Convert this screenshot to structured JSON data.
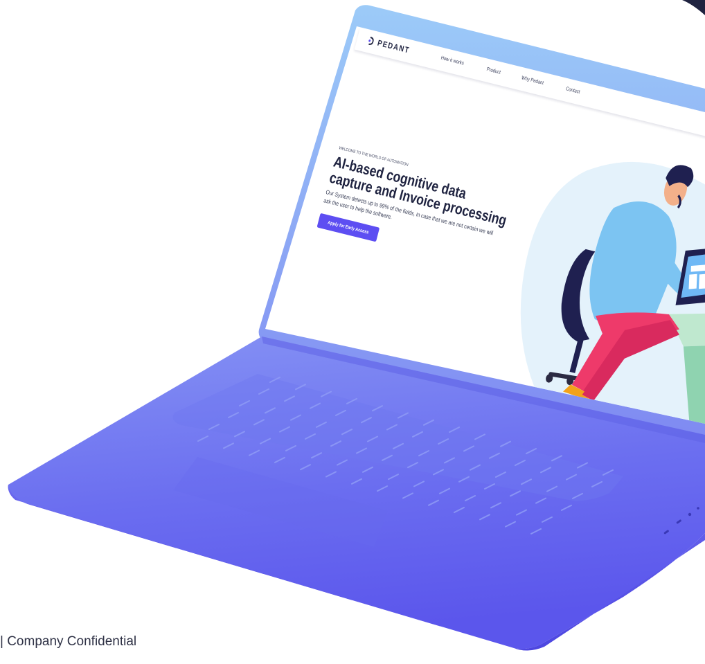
{
  "site": {
    "logo_text": "PEDANT",
    "nav": [
      "How it works",
      "Product",
      "Why Pedant",
      "Contact"
    ],
    "kicker": "WELCOME TO THE WORLD OF AUTOMATION",
    "title_lines": [
      "AI-based cognitive data",
      "capture and Invoice processing"
    ],
    "description": "Our System detects up to 99% of the fields, in case that we are not certain we will ask the user to help the software.",
    "cta_label": "Apply for Early Access"
  },
  "footer": {
    "confidential": "| Company Confidential"
  },
  "colors": {
    "accent": "#5d4ef2",
    "laptop_body": "#6a6ff0",
    "screen_bezel": "#8fc2f7",
    "blob": "#e4f2fb"
  },
  "icons": [
    "pedant-logo-icon",
    "person-at-desk-illustration",
    "laptop-icon",
    "mug-icon",
    "folder-icon",
    "pie-chart-icon",
    "office-chair-icon"
  ]
}
